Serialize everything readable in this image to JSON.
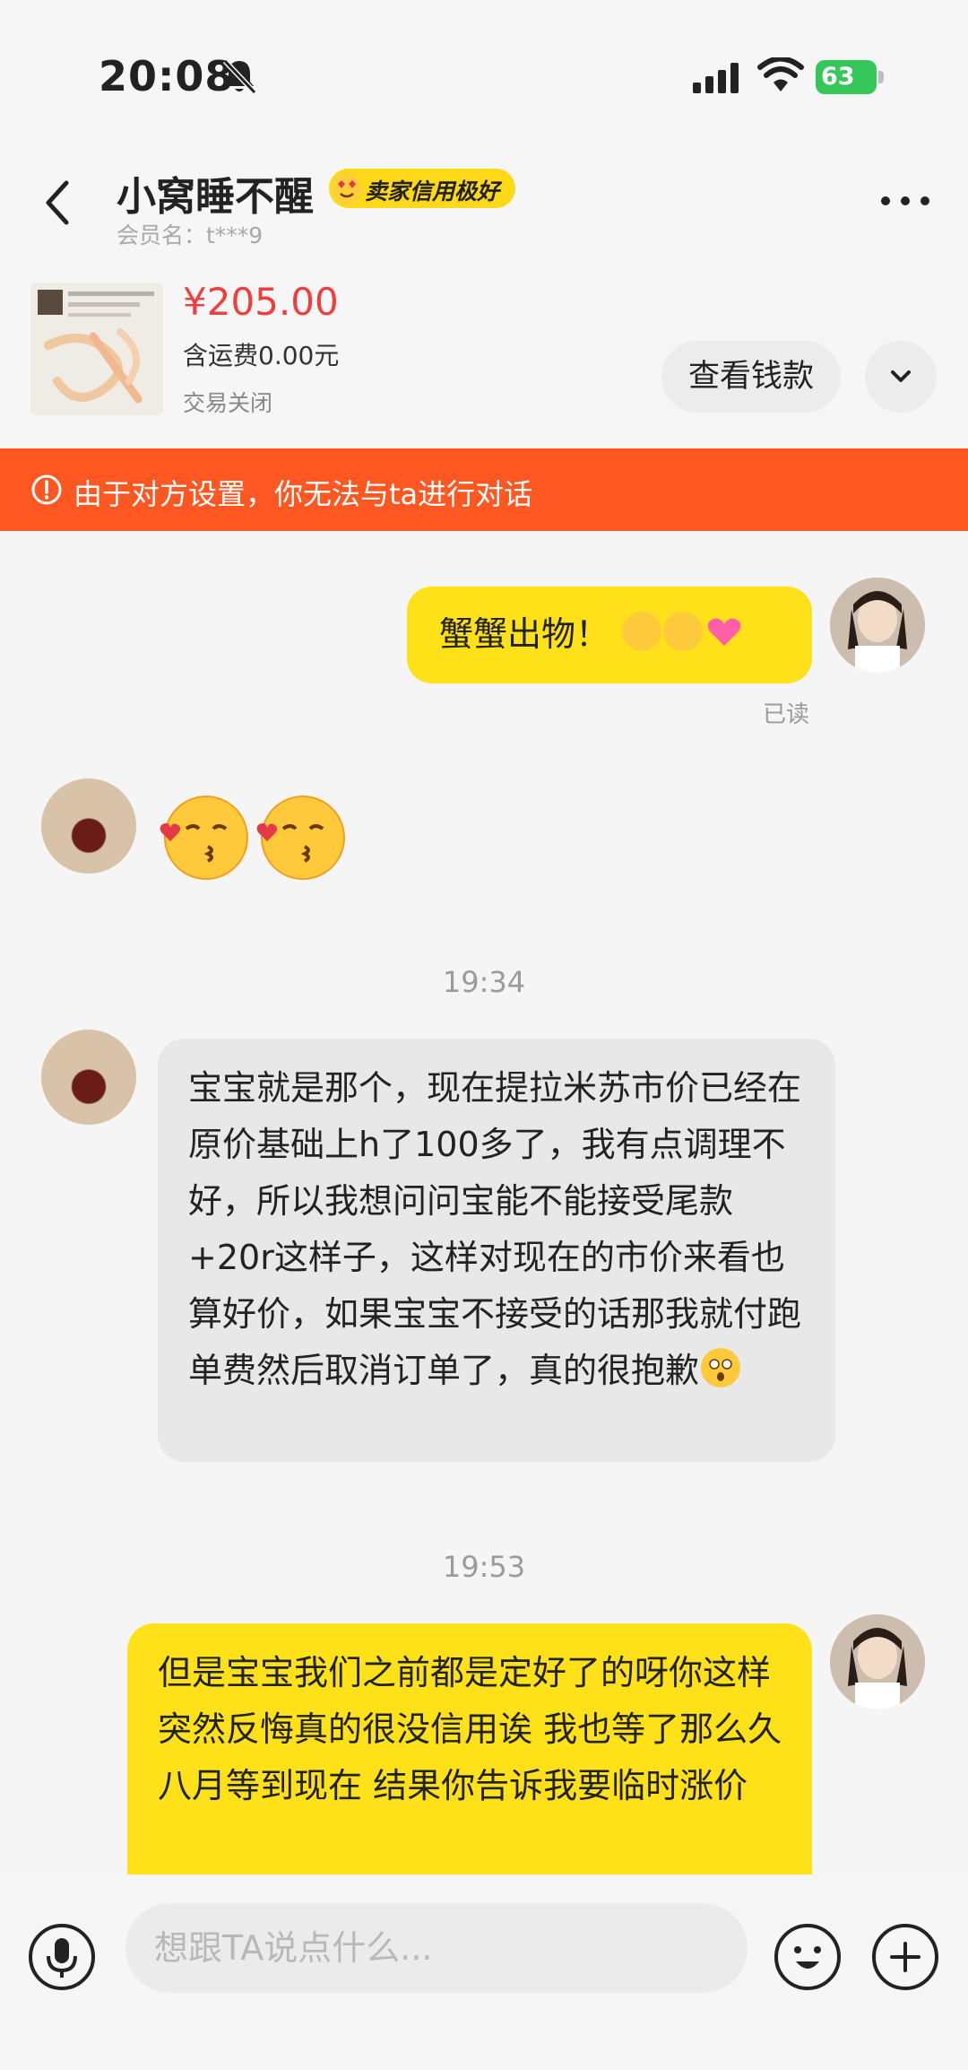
{
  "status_bar": {
    "time": "20:08",
    "battery": "63"
  },
  "header": {
    "nickname": "小窝睡不醒",
    "credit_badge": "卖家信用极好",
    "member_label": "会员名：t***9"
  },
  "order": {
    "price": "¥205.00",
    "shipping": "含运费0.00元",
    "status": "交易关闭",
    "check_button": "查看钱款"
  },
  "warning": {
    "text": "由于对方设置，你无法与ta进行对话"
  },
  "messages": {
    "m1": {
      "text": "蟹蟹出物！",
      "read": "已读"
    },
    "t1": "19:34",
    "m3": {
      "text": "宝宝就是那个，现在提拉米苏市价已经在原价基础上h了100多了，我有点调理不好，所以我想问问宝能不能接受尾款+20r这样子，这样对现在的市价来看也算好价，如果宝宝不接受的话那我就付跑单费然后取消订单了，真的很抱歉"
    },
    "t2": "19:53",
    "m4": {
      "text": "但是宝宝我们之前都是定好了的呀你这样突然反悔真的很没信用诶 我也等了那么久 八月等到现在 结果你告诉我要临时涨价"
    }
  },
  "input": {
    "placeholder": "想跟TA说点什么..."
  },
  "colors": {
    "accent_yellow": "#ffe11a",
    "warning_orange": "#ff5722",
    "price_red": "#f23d3d",
    "battery_green": "#35c759"
  }
}
